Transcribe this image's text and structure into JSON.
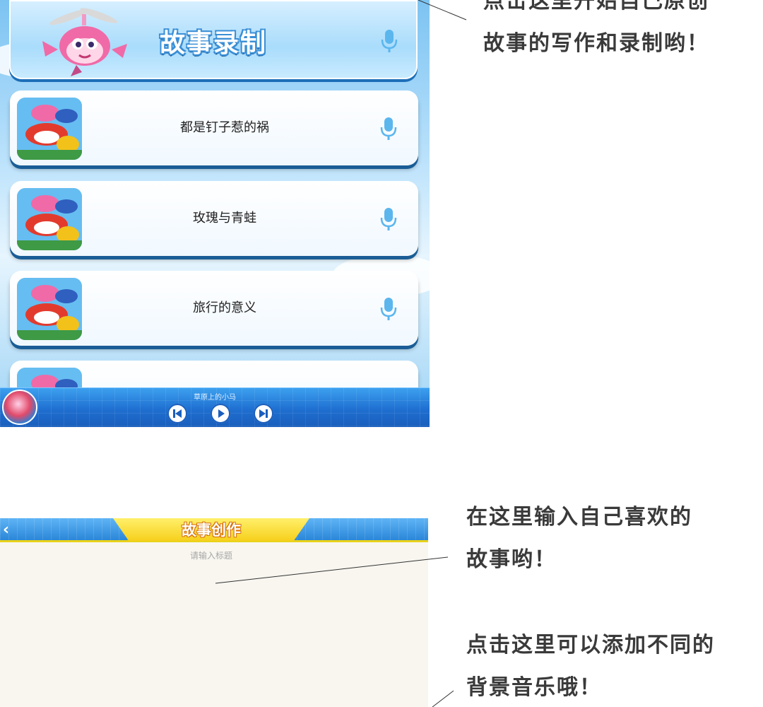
{
  "screen1": {
    "header_title": "故事录制",
    "stories": [
      {
        "title": "都是钉子惹的祸"
      },
      {
        "title": "玫瑰与青蛙"
      },
      {
        "title": "旅行的意义"
      },
      {
        "title": ""
      }
    ],
    "player": {
      "now_playing": "草原上的小马"
    }
  },
  "screen2": {
    "nav_title": "故事创作",
    "title_placeholder": "请输入标题"
  },
  "annotations": {
    "top_line1": "点击这里开始自己原创",
    "top_line2": "故事的写作和录制哟！",
    "mid_line1": "在这里输入自己喜欢的",
    "mid_line2": "故事哟！",
    "bottom_line1": "点击这里可以添加不同的",
    "bottom_line2": "背景音乐哦！"
  },
  "colors": {
    "accent_blue": "#2a86d8",
    "banner_yellow": "#f6d01c",
    "mic_blue": "#5bb6ee",
    "annotation_text": "#3a3a3a"
  }
}
